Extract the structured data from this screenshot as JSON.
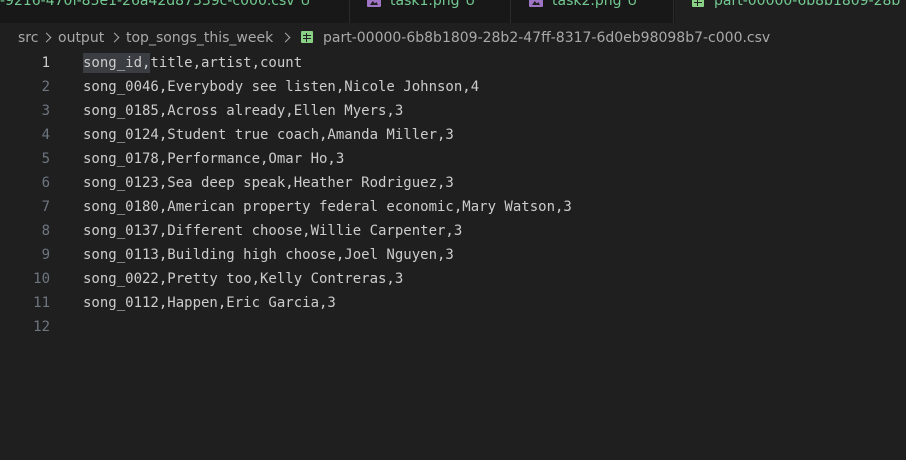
{
  "tabs": [
    {
      "label": "-9216-470f-85e1-26a42d87339c-c000.csv",
      "badge": "U",
      "icon": "csv-file-icon",
      "active": false
    },
    {
      "label": "task1.png",
      "badge": "U",
      "icon": "image-file-icon",
      "active": false
    },
    {
      "label": "task2.png",
      "badge": "U",
      "icon": "image-file-icon",
      "active": false
    },
    {
      "label": "part-00000-6b8b1809-28b",
      "badge": "",
      "icon": "csv-file-icon",
      "active": true
    }
  ],
  "breadcrumb": {
    "items": [
      "src",
      "output",
      "top_songs_this_week"
    ],
    "file": "part-00000-6b8b1809-28b2-47ff-8317-6d0eb98098b7-c000.csv"
  },
  "editor": {
    "current_line": 1,
    "lines": [
      {
        "number": "1",
        "text": "song_id,title,artist,count"
      },
      {
        "number": "2",
        "text": "song_0046,Everybody see listen,Nicole Johnson,4"
      },
      {
        "number": "3",
        "text": "song_0185,Across already,Ellen Myers,3"
      },
      {
        "number": "4",
        "text": "song_0124,Student true coach,Amanda Miller,3"
      },
      {
        "number": "5",
        "text": "song_0178,Performance,Omar Ho,3"
      },
      {
        "number": "6",
        "text": "song_0123,Sea deep speak,Heather Rodriguez,3"
      },
      {
        "number": "7",
        "text": "song_0180,American property federal economic,Mary Watson,3"
      },
      {
        "number": "8",
        "text": "song_0137,Different choose,Willie Carpenter,3"
      },
      {
        "number": "9",
        "text": "song_0113,Building high choose,Joel Nguyen,3"
      },
      {
        "number": "10",
        "text": "song_0022,Pretty too,Kelly Contreras,3"
      },
      {
        "number": "11",
        "text": "song_0112,Happen,Eric Garcia,3"
      },
      {
        "number": "12",
        "text": ""
      }
    ]
  },
  "colors": {
    "background": "#1f1f1f",
    "tab_modified_text": "#73c991",
    "csv_icon": "#89d185",
    "image_icon": "#a074c4",
    "word_highlight": "#3a3d41"
  }
}
